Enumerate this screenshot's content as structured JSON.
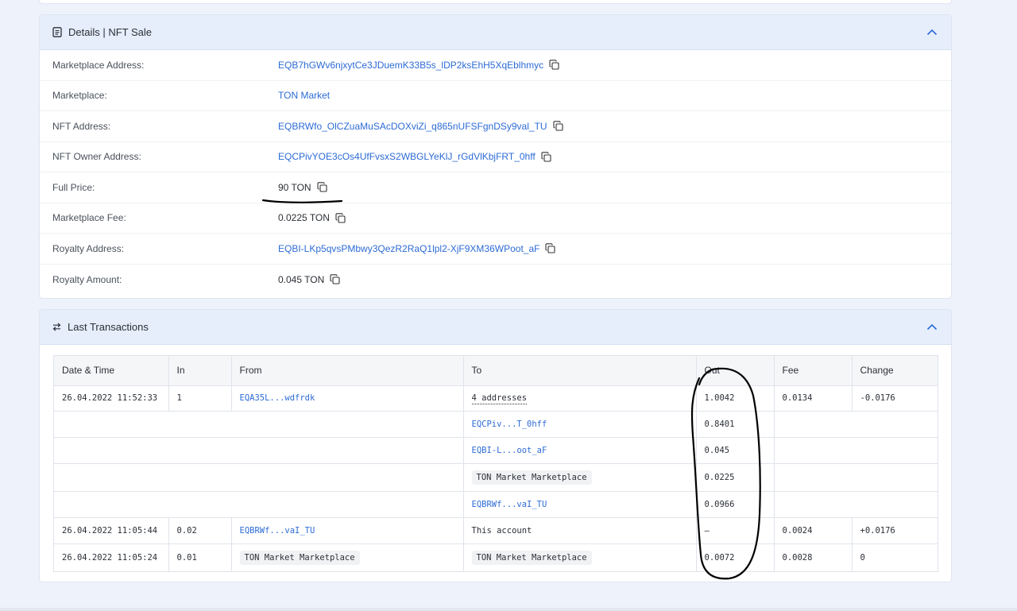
{
  "details": {
    "title": "Details | NFT Sale",
    "rows": [
      {
        "label": "Marketplace Address:",
        "value": "EQB7hGWv6njxytCe3JDuemK33B5s_lDP2ksEhH5XqEblhmyc"
      },
      {
        "label": "Marketplace:",
        "value": "TON Market"
      },
      {
        "label": "NFT Address:",
        "value": "EQBRWfo_OlCZuaMuSAcDOXviZi_q865nUFSFgnDSy9val_TU"
      },
      {
        "label": "NFT Owner Address:",
        "value": "EQCPivYOE3cOs4UfFvsxS2WBGLYeKlJ_rGdVlKbjFRT_0hff"
      },
      {
        "label": "Full Price:",
        "value": "90 TON"
      },
      {
        "label": "Marketplace Fee:",
        "value": "0.0225 TON"
      },
      {
        "label": "Royalty Address:",
        "value": "EQBI-LKp5qvsPMbwy3QezR2RaQ1lpl2-XjF9XM36WPoot_aF"
      },
      {
        "label": "Royalty Amount:",
        "value": "0.045 TON"
      }
    ]
  },
  "transactions": {
    "title": "Last Transactions",
    "columns": [
      "Date & Time",
      "In",
      "From",
      "To",
      "Out",
      "Fee",
      "Change"
    ],
    "rows": [
      {
        "date": "26.04.2022 11:52:33",
        "in": "1",
        "from": "EQA35L...wdfrdk",
        "to": "4 addresses",
        "out": "1.0042",
        "fee": "0.0134",
        "change": "-0.0176"
      },
      {
        "to": "EQCPiv...T_0hff",
        "out": "0.8401"
      },
      {
        "to": "EQBI-L...oot_aF",
        "out": "0.045"
      },
      {
        "to": "TON Market Marketplace",
        "out": "0.0225"
      },
      {
        "to": "EQBRWf...vaI_TU",
        "out": "0.0966"
      },
      {
        "date": "26.04.2022 11:05:44",
        "in": "0.02",
        "from": "EQBRWf...vaI_TU",
        "to": "This account",
        "out": "–",
        "fee": "0.0024",
        "change": "+0.0176"
      },
      {
        "date": "26.04.2022 11:05:24",
        "in": "0.01",
        "from": "TON Market Marketplace",
        "to": "TON Market Marketplace",
        "out": "0.0072",
        "fee": "0.0028",
        "change": "0"
      }
    ]
  },
  "icons": {
    "details_header": "document-icon",
    "transactions_header": "swap-arrows-icon",
    "collapse": "chevron-up-icon",
    "copy": "copy-icon"
  },
  "colors": {
    "link": "#2d6bd6",
    "header_bg": "#e6eefb",
    "page_bg": "#eef2fb"
  }
}
